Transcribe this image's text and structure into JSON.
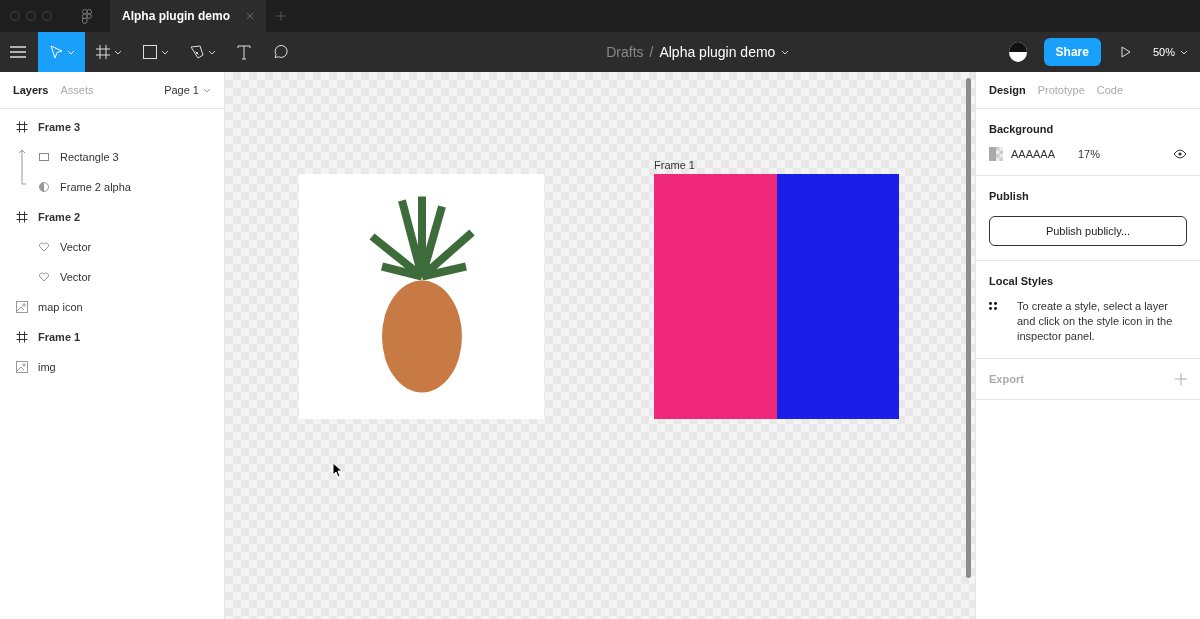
{
  "window": {
    "tab_title": "Alpha plugin demo"
  },
  "toolbar": {
    "tools": [
      {
        "kind": "move",
        "selected": true,
        "dropdown": true
      },
      {
        "kind": "frame",
        "selected": false,
        "dropdown": true
      },
      {
        "kind": "shape",
        "selected": false,
        "dropdown": true
      },
      {
        "kind": "pen",
        "selected": false,
        "dropdown": true
      },
      {
        "kind": "text",
        "selected": false,
        "dropdown": false
      },
      {
        "kind": "comment",
        "selected": false,
        "dropdown": false
      }
    ],
    "breadcrumb": {
      "parent": "Drafts",
      "separator": "/",
      "file": "Alpha plugin demo"
    },
    "share": "Share",
    "zoom": "50%"
  },
  "left_panel": {
    "tabs": [
      {
        "label": "Layers",
        "selected": true
      },
      {
        "label": "Assets",
        "selected": false
      }
    ],
    "page": "Page 1",
    "layers": [
      {
        "kind": "frame",
        "name": "Frame 3",
        "children": [
          {
            "kind": "rect",
            "name": "Rectangle 3"
          },
          {
            "kind": "mask",
            "name": "Frame 2 alpha"
          }
        ]
      },
      {
        "kind": "frame",
        "name": "Frame 2",
        "children": [
          {
            "kind": "vector",
            "name": "Vector"
          },
          {
            "kind": "vector",
            "name": "Vector"
          }
        ]
      },
      {
        "kind": "image",
        "name": "map icon"
      },
      {
        "kind": "frame",
        "name": "Frame 1"
      },
      {
        "kind": "image",
        "name": "img"
      }
    ]
  },
  "canvas": {
    "frame_label": "Frame 1",
    "frame_fills": [
      {
        "color": "#f0287a"
      },
      {
        "color": "#1a1ee8"
      }
    ]
  },
  "right_panel": {
    "tabs": [
      {
        "label": "Design",
        "selected": true
      },
      {
        "label": "Prototype",
        "selected": false
      },
      {
        "label": "Code",
        "selected": false
      }
    ],
    "background": {
      "title": "Background",
      "hex": "AAAAAA",
      "opacity": "17%"
    },
    "publish": {
      "title": "Publish",
      "button": "Publish publicly..."
    },
    "local_styles": {
      "title": "Local Styles",
      "hint": "To create a style, select a layer and click on the style icon in the inspector panel."
    },
    "export": {
      "title": "Export"
    }
  }
}
